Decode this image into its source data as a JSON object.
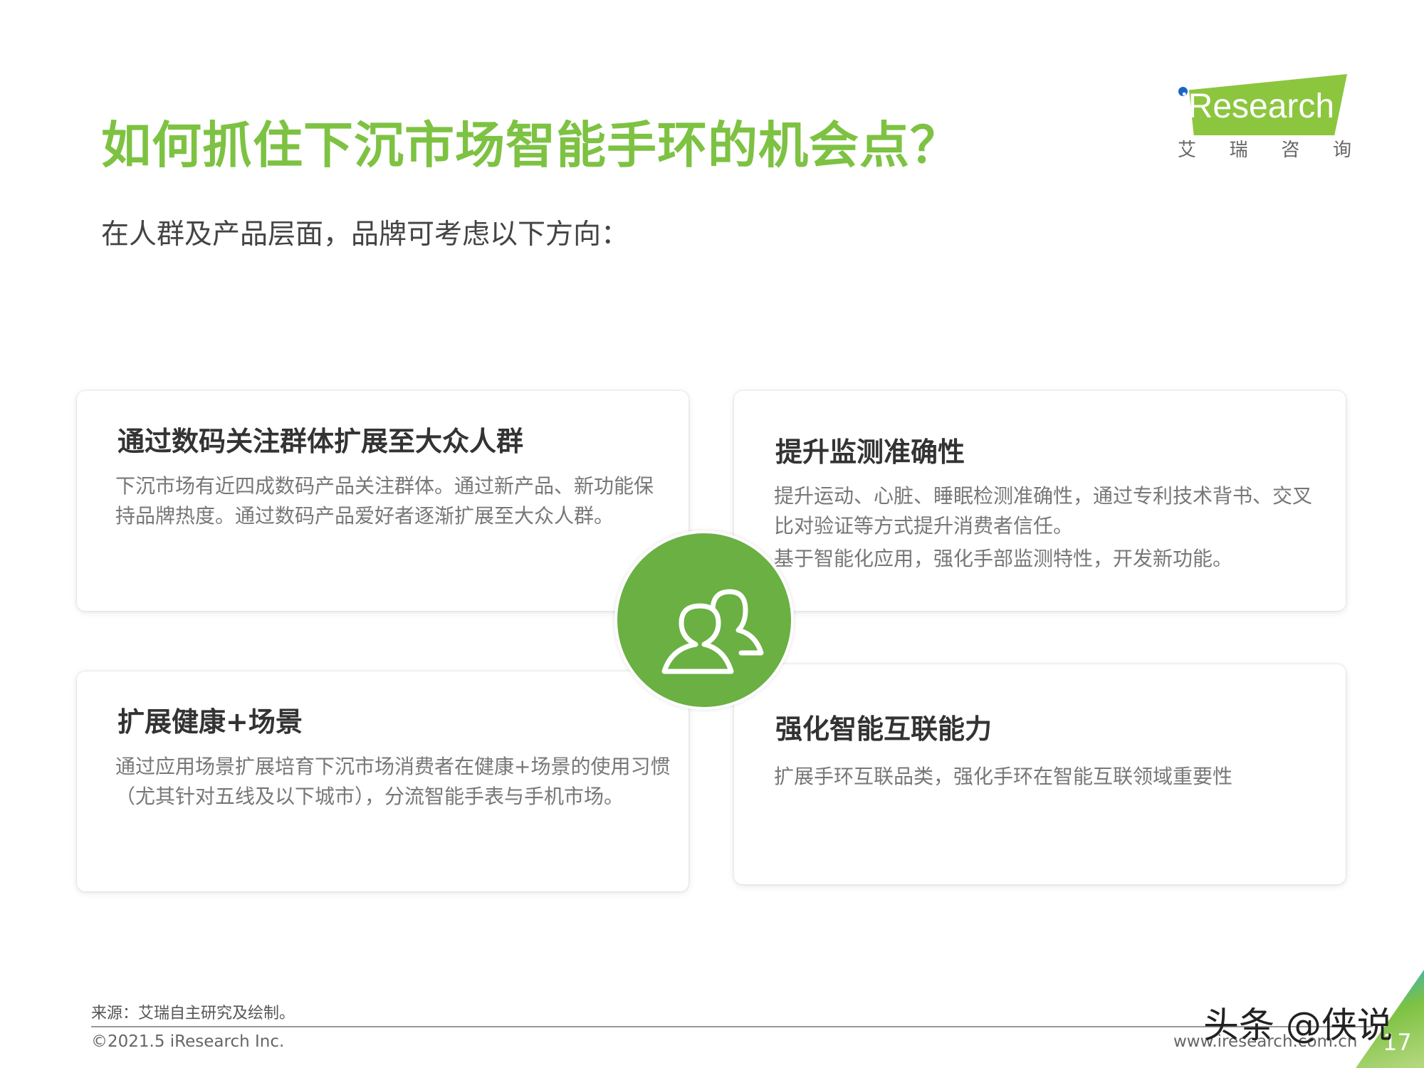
{
  "header": {
    "title": "如何抓住下沉市场智能手环的机会点？",
    "subtitle": "在人群及产品层面，品牌可考虑以下方向："
  },
  "logo": {
    "brand": "iResearch",
    "cn_chars": [
      "艾",
      "瑞",
      "咨",
      "询"
    ]
  },
  "cards": [
    {
      "title": "通过数码关注群体扩展至大众人群",
      "body": [
        "下沉市场有近四成数码产品关注群体。通过新产品、新功能保持品牌热度。通过数码产品爱好者逐渐扩展至大众人群。"
      ]
    },
    {
      "title": "提升监测准确性",
      "body": [
        "提升运动、心脏、睡眠检测准确性，通过专利技术背书、交叉比对验证等方式提升消费者信任。",
        "基于智能化应用，强化手部监测特性，开发新功能。"
      ]
    },
    {
      "title": "扩展健康+场景",
      "body": [
        "通过应用场景扩展培育下沉市场消费者在健康+场景的使用习惯（尤其针对五线及以下城市），分流智能手表与手机市场。"
      ]
    },
    {
      "title": "强化智能互联能力",
      "body": [
        "扩展手环互联品类，强化手环在智能互联领域重要性"
      ]
    }
  ],
  "center_icon": "users-icon",
  "footer": {
    "source": "来源：艾瑞自主研究及绘制。",
    "copyright": "©2021.5 iResearch Inc.",
    "website": "www.iresearch.com.cn",
    "page_number": "17",
    "watermark": "头条 @侠说"
  },
  "colors": {
    "title_green": "#7dc242",
    "circle_green": "#6ab043",
    "logo_green": "#8cc63f",
    "logo_blue_dot": "#1a66c6"
  }
}
